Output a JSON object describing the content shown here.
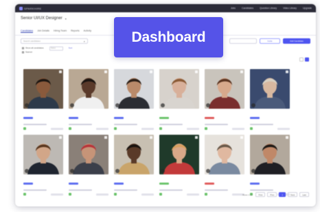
{
  "overlay": {
    "label": "Dashboard"
  },
  "app": {
    "logo_text": "SPARKHIRE",
    "top_nav": [
      "Jobs",
      "Candidates",
      "Question Library",
      "Video Library",
      "Upgrade"
    ],
    "job_title": "Senior UI/UX Designer",
    "tabs": [
      "Candidates",
      "Job Details",
      "Hiring Team",
      "Reports",
      "Activity"
    ]
  },
  "toolbar": {
    "search_placeholder": "Search candidates",
    "invite_label": "Invite",
    "add_label": "Add Candidate"
  },
  "filters": {
    "option_1": "Show all candidates",
    "option_2": "Starred",
    "status_placeholder": "Status",
    "sort_label": "Sort"
  },
  "colors": {
    "accent": "#4e55f0",
    "overlay_bg": "#5553e8",
    "topbar": "#2b2b38",
    "tag_blue": "#5b6cf0",
    "tag_red": "#e05a5a",
    "tag_green": "#6ac36a"
  },
  "candidates": [
    {
      "bg": "#6b5a49",
      "skin": "#8a5a3c",
      "hair": "#1e1712",
      "shirt": "#2d3a4a",
      "tag": "#5b6cf0"
    },
    {
      "bg": "#b9a894",
      "skin": "#5a3a2a",
      "hair": "#1a1410",
      "shirt": "#f0f0f0",
      "tag": "#5b6cf0"
    },
    {
      "bg": "#d6d8dc",
      "skin": "#b98a6a",
      "hair": "#2c2018",
      "shirt": "#2b2d33",
      "tag": "#5b6cf0"
    },
    {
      "bg": "#d7d2cc",
      "skin": "#d8b09a",
      "hair": "#8a5a35",
      "shirt": "#d8d4cf",
      "tag": "#6ac36a"
    },
    {
      "bg": "#c9c4bc",
      "skin": "#d7a98c",
      "hair": "#5a3522",
      "shirt": "#7a2e2e",
      "tag": "#e05a5a"
    },
    {
      "bg": "#3a4a6e",
      "skin": "#d8b8a0",
      "hair": "#d8d0c2",
      "shirt": "#4a5a7a",
      "tag": "#5b6cf0"
    },
    {
      "bg": "#bdb9b4",
      "skin": "#d2a688",
      "hair": "#5a3820",
      "shirt": "#1f2530",
      "tag": "#5b6cf0"
    },
    {
      "bg": "#8a8078",
      "skin": "#c69478",
      "hair": "#b8353a",
      "shirt": "#3b3f4a",
      "tag": "#5b6cf0"
    },
    {
      "bg": "#c8c0b2",
      "skin": "#5a3a28",
      "hair": "#1a1410",
      "shirt": "#c9a46a",
      "tag": "#5b6cf0"
    },
    {
      "bg": "#1f3a2a",
      "skin": "#d8a888",
      "hair": "#d8a060",
      "shirt": "#c23a3a",
      "tag": "#6ac36a"
    },
    {
      "bg": "#e6e2dc",
      "skin": "#e0b8a0",
      "hair": "#6a5a4a",
      "shirt": "#7a8aa0",
      "tag": "#e05a5a"
    },
    {
      "bg": "#b2a89c",
      "skin": "#c08868",
      "hair": "#1f1a16",
      "shirt": "#1f1f24",
      "tag": "#5b6cf0"
    }
  ],
  "pagination": {
    "label": "Rows 1-12",
    "prev_label": "Prev",
    "first_label": "First",
    "current_page": "1",
    "next_label": "Next",
    "last_label": "Last"
  }
}
